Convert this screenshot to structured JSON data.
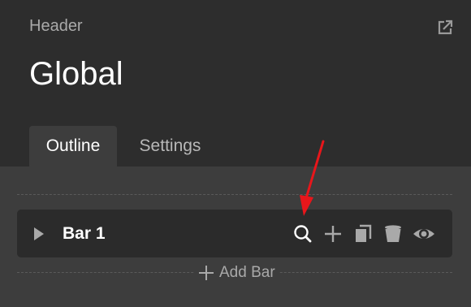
{
  "header": {
    "label": "Header",
    "title": "Global"
  },
  "tabs": [
    {
      "label": "Outline",
      "active": true
    },
    {
      "label": "Settings",
      "active": false
    }
  ],
  "bars": [
    {
      "label": "Bar 1",
      "actions": [
        "search-icon",
        "plus-icon",
        "duplicate-icon",
        "trash-icon",
        "eye-icon"
      ]
    }
  ],
  "add_bar": {
    "label": "Add Bar"
  },
  "colors": {
    "background": "#2d2d2d",
    "panel": "#3d3d3d",
    "row": "#2b2b2b",
    "annotation": "#e8161b"
  }
}
